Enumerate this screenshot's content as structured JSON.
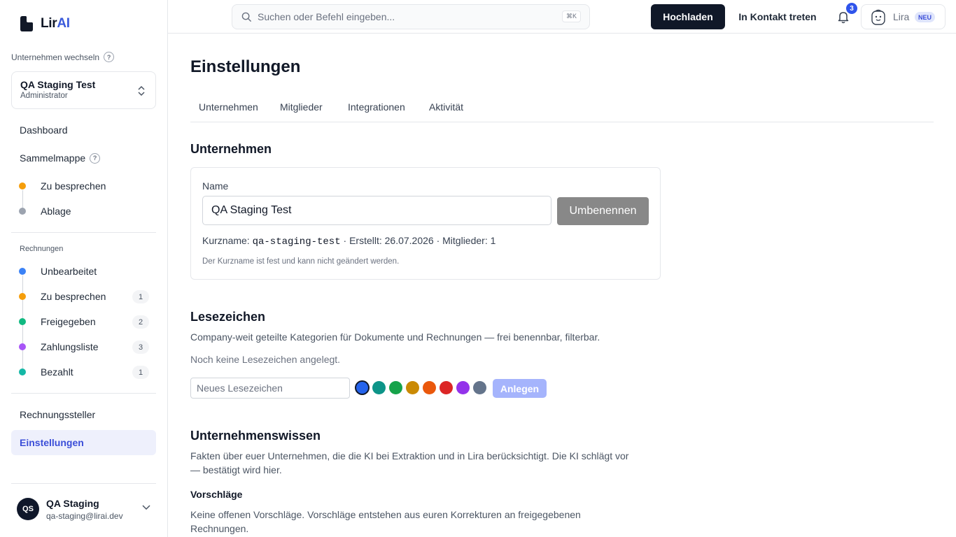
{
  "brand": {
    "name_prefix": "Lir",
    "name_suffix": "AI"
  },
  "company_switch": {
    "label": "Unternehmen wechseln",
    "help": "?",
    "company_name": "QA Staging Test",
    "role": "Administrator"
  },
  "sidebar": {
    "dashboard": "Dashboard",
    "collection": "Sammelmappe",
    "collection_help": "?",
    "collection_items": [
      {
        "label": "Zu besprechen",
        "color": "#f59e0b"
      },
      {
        "label": "Ablage",
        "color": "#9ca3af"
      }
    ],
    "invoices_label": "Rechnungen",
    "invoice_items": [
      {
        "label": "Unbearbeitet",
        "color": "#3b82f6",
        "count": ""
      },
      {
        "label": "Zu besprechen",
        "color": "#f59e0b",
        "count": "1"
      },
      {
        "label": "Freigegeben",
        "color": "#10b981",
        "count": "2"
      },
      {
        "label": "Zahlungsliste",
        "color": "#a855f7",
        "count": "3"
      },
      {
        "label": "Bezahlt",
        "color": "#14b8a6",
        "count": "1"
      }
    ],
    "issuers": "Rechnungssteller",
    "settings": "Einstellungen"
  },
  "user": {
    "initials": "QS",
    "name": "QA Staging",
    "email": "qa-staging@lirai.dev"
  },
  "topbar": {
    "search_placeholder": "Suchen oder Befehl eingeben...",
    "shortcut": "⌘K",
    "upload": "Hochladen",
    "contact": "In Kontakt treten",
    "notification_count": "3",
    "assistant_name": "Lira",
    "assistant_badge": "NEU"
  },
  "page": {
    "title": "Einstellungen",
    "tabs": [
      "Unternehmen",
      "Mitglieder",
      "Integrationen",
      "Aktivität"
    ],
    "company_section": {
      "heading": "Unternehmen",
      "name_label": "Name",
      "name_value": "QA Staging Test",
      "rename_button": "Umbenennen",
      "shortname_label": "Kurzname:",
      "shortname_value": "qa-staging-test",
      "created_text": "· Erstellt: 26.07.2026 · Mitglieder: 1",
      "hint": "Der Kurzname ist fest und kann nicht geändert werden."
    },
    "bookmarks_section": {
      "heading": "Lesezeichen",
      "description": "Company-weit geteilte Kategorien für Dokumente und Rechnungen — frei benennbar, filterbar.",
      "empty": "Noch keine Lesezeichen angelegt.",
      "input_placeholder": "Neues Lesezeichen",
      "colors": [
        "#2563eb",
        "#0d9488",
        "#16a34a",
        "#ca8a04",
        "#ea580c",
        "#dc2626",
        "#9333ea",
        "#64748b"
      ],
      "create_button": "Anlegen"
    },
    "knowledge_section": {
      "heading": "Unternehmenswissen",
      "description_line1": "Fakten über euer Unternehmen, die die KI bei Extraktion und in Lira berücksichtigt. Die KI schlägt vor",
      "description_line2": "— bestätigt wird hier.",
      "suggestions_heading": "Vorschläge",
      "suggestions_line1": "Keine offenen Vorschläge. Vorschläge entstehen aus euren Korrekturen an freigegebenen",
      "suggestions_line2": "Rechnungen."
    }
  }
}
